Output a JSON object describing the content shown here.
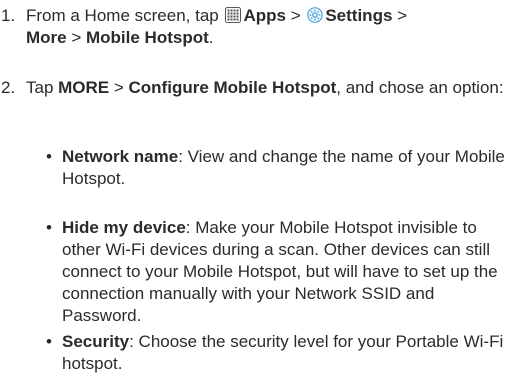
{
  "steps": [
    {
      "number": "1.",
      "text_from": "From a Home screen, tap ",
      "apps": "Apps",
      "sep1": " > ",
      "settings": "Settings",
      "sep2": " > ",
      "more": "More",
      "sep3": " > ",
      "hotspot": "Mobile Hotspot",
      "period": "."
    },
    {
      "number": "2.",
      "text_tap": "Tap ",
      "more_caps": "MORE",
      "sep": " > ",
      "configure": "Configure Mobile Hotspot",
      "rest": ", and chose an option:"
    }
  ],
  "options": [
    {
      "term": "Network name",
      "desc": ": View and change the name of your Mobile Hotspot."
    },
    {
      "term": "Hide my device",
      "desc": ": Make your Mobile Hotspot invisible to other Wi-Fi devices during a scan. Other devices can still connect to your Mobile Hotspot, but will have to set up the connection manually with your Network SSID and Password."
    },
    {
      "term": "Security",
      "desc": ": Choose the security level for your Portable Wi-Fi hotspot."
    }
  ],
  "icons": {
    "apps": "apps-grid-icon",
    "settings": "settings-gear-icon",
    "bullet": "•"
  },
  "colors": {
    "text": "#2b2b2b",
    "icon_accent": "#3a9ad9"
  }
}
